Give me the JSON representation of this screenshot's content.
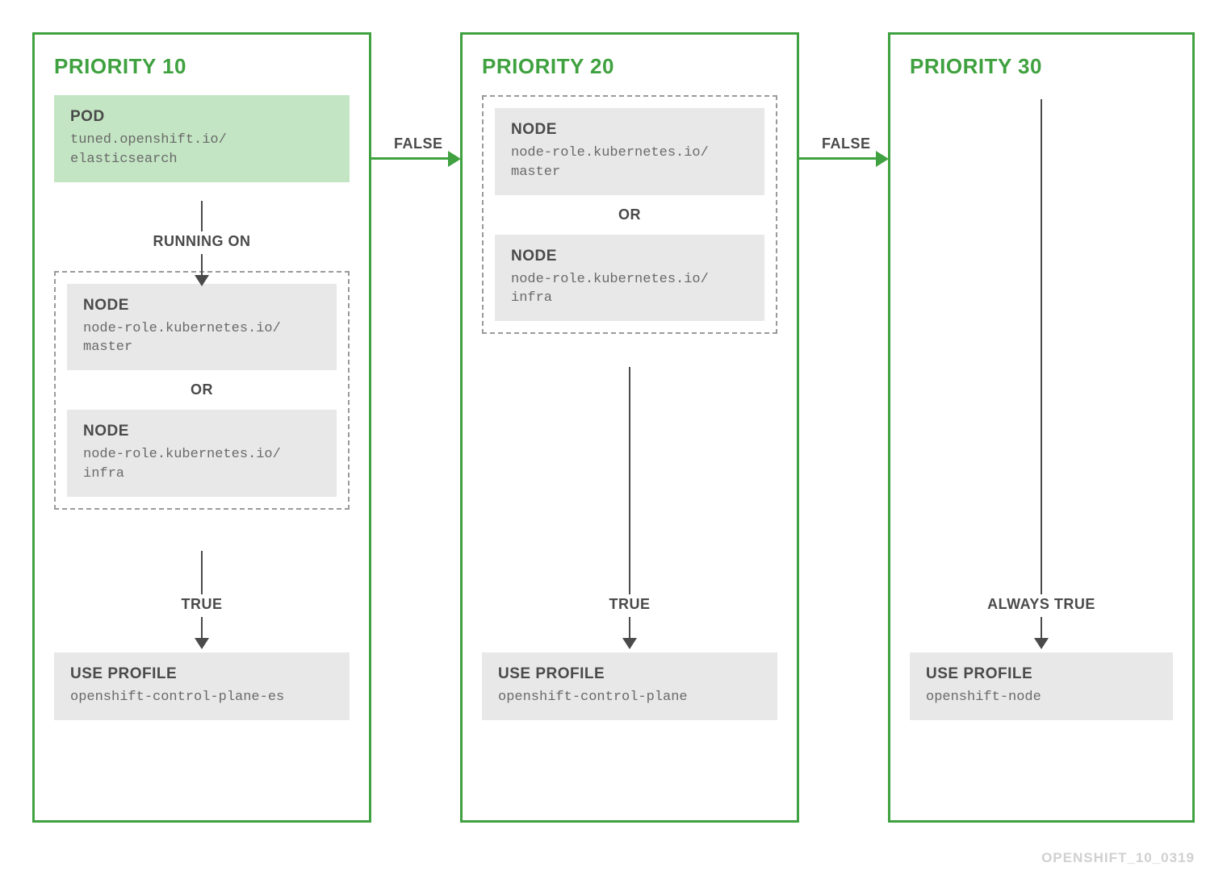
{
  "colors": {
    "accent": "#3fa13f",
    "text": "#4a4a4a",
    "grey_bg": "#e8e8e8",
    "pod_bg": "#c3e5c3"
  },
  "footer": "OPENSHIFT_10_0319",
  "labels": {
    "false": "FALSE",
    "true": "TRUE",
    "always_true": "ALWAYS TRUE",
    "running_on": "RUNNING ON",
    "or": "OR",
    "use_profile": "USE PROFILE",
    "node": "NODE",
    "pod": "POD"
  },
  "priorities": [
    {
      "title": "PRIORITY 10",
      "pod": {
        "label": "tuned.openshift.io/\nelasticsearch"
      },
      "nodes": [
        {
          "label": "node-role.kubernetes.io/\nmaster"
        },
        {
          "label": "node-role.kubernetes.io/\ninfra"
        }
      ],
      "profile": "openshift-control-plane-es"
    },
    {
      "title": "PRIORITY 20",
      "nodes": [
        {
          "label": "node-role.kubernetes.io/\nmaster"
        },
        {
          "label": "node-role.kubernetes.io/\ninfra"
        }
      ],
      "profile": "openshift-control-plane"
    },
    {
      "title": "PRIORITY 30",
      "profile": "openshift-node"
    }
  ]
}
